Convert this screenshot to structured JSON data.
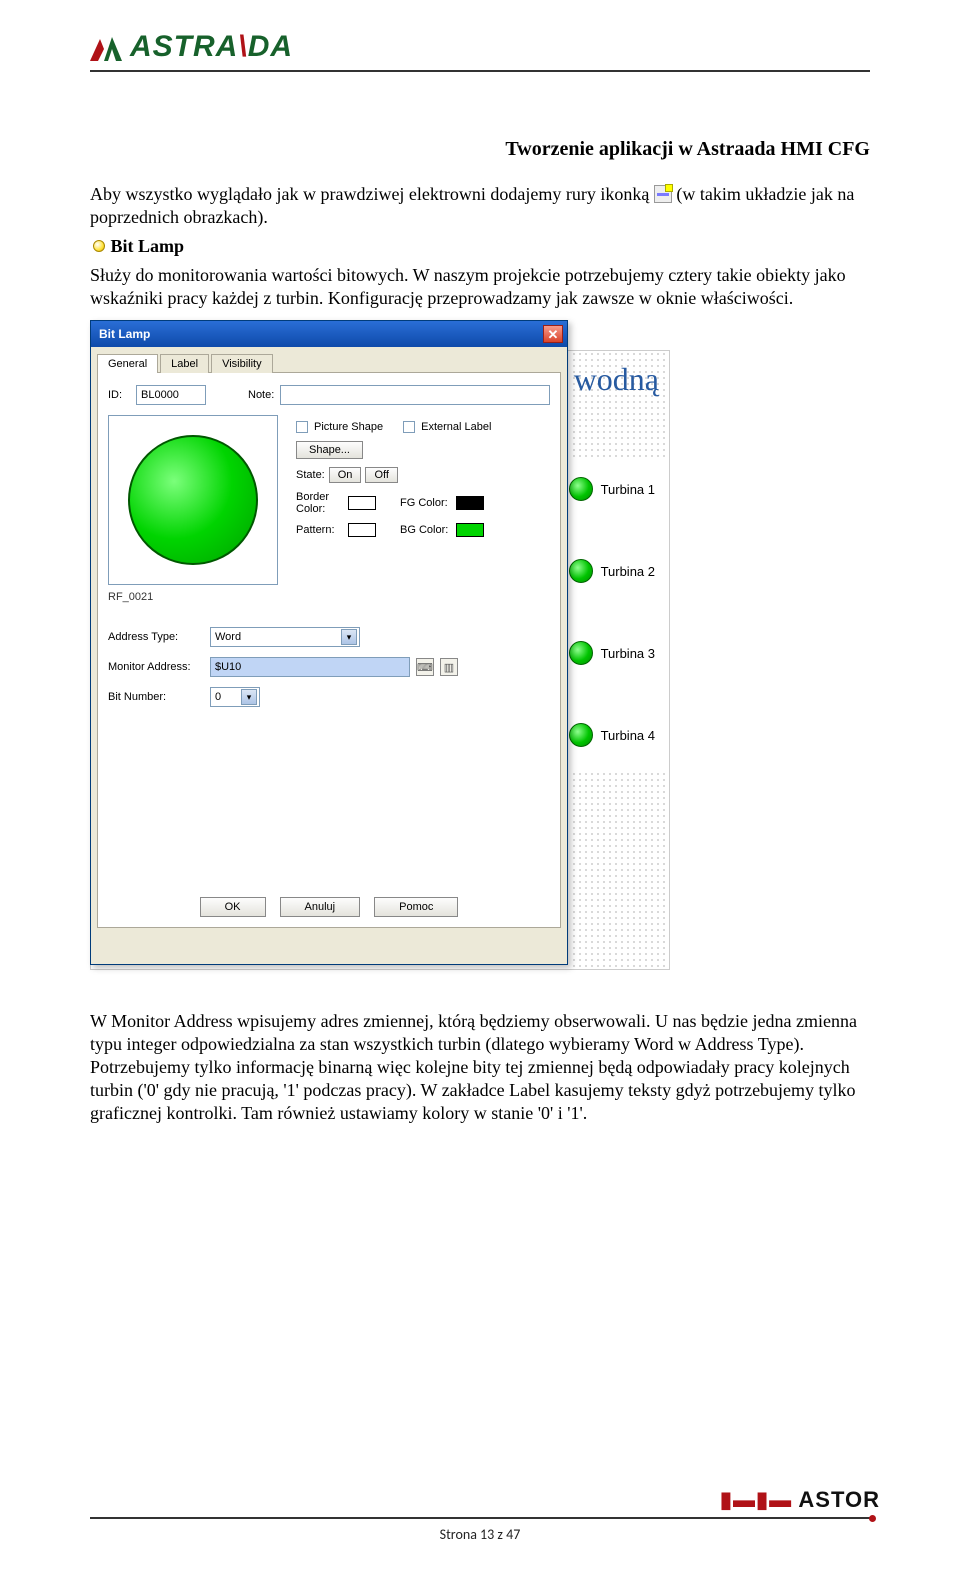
{
  "header": {
    "logo_text_pre": "ASTRA",
    "logo_text_red": "\\",
    "logo_text_post": "DA",
    "doc_title": "Tworzenie aplikacji w Astraada HMI CFG"
  },
  "para1_a": "Aby wszystko wyglądało jak w prawdziwej elektrowni dodajemy rury ikonką ",
  "para1_b": " (w takim układzie jak na poprzednich obrazkach).",
  "section2_title": "Bit Lamp",
  "para2": "Służy do monitorowania wartości bitowych. W naszym projekcie potrzebujemy cztery takie obiekty jako wskaźniki pracy każdej z turbin. Konfigurację przeprowadzamy jak zawsze w oknie właściwości.",
  "backdrop": {
    "title_fragment": "wodną",
    "turbines": [
      "Turbina 1",
      "Turbina 2",
      "Turbina 3",
      "Turbina 4"
    ]
  },
  "dialog": {
    "title": "Bit Lamp",
    "tabs": [
      "General",
      "Label",
      "Visibility"
    ],
    "id_label": "ID:",
    "id_value": "BL0000",
    "note_label": "Note:",
    "note_value": "",
    "picture_shape": "Picture Shape",
    "external_label": "External Label",
    "shape_btn": "Shape...",
    "state_label": "State:",
    "state_on": "On",
    "state_off": "Off",
    "border_color_lbl": "Border Color:",
    "fg_color_lbl": "FG Color:",
    "pattern_lbl": "Pattern:",
    "bg_color_lbl": "BG Color:",
    "preview_caption": "RF_0021",
    "addr_type_lbl": "Address Type:",
    "addr_type_val": "Word",
    "mon_addr_lbl": "Monitor Address:",
    "mon_addr_val": "$U10",
    "bit_num_lbl": "Bit Number:",
    "bit_num_val": "0",
    "ok": "OK",
    "cancel": "Anuluj",
    "help": "Pomoc",
    "colors": {
      "border": "#ffffff",
      "fg": "#000000",
      "pattern": "#ffffff",
      "bg": "#00d400"
    }
  },
  "para3": "W Monitor Address wpisujemy adres zmiennej, którą będziemy obserwowali. U nas będzie jedna zmienna typu integer odpowiedzialna za stan wszystkich turbin (dlatego wybieramy Word w Address Type). Potrzebujemy tylko informację binarną więc kolejne bity tej zmiennej będą odpowiadały pracy kolejnych turbin ('0' gdy nie pracują, '1' podczas pracy). W zakładce Label kasujemy teksty gdyż potrzebujemy tylko graficznej kontrolki. Tam również ustawiamy kolory w stanie '0' i '1'.",
  "footer": {
    "brand": "ASTOR",
    "page": "Strona 13 z 47"
  }
}
